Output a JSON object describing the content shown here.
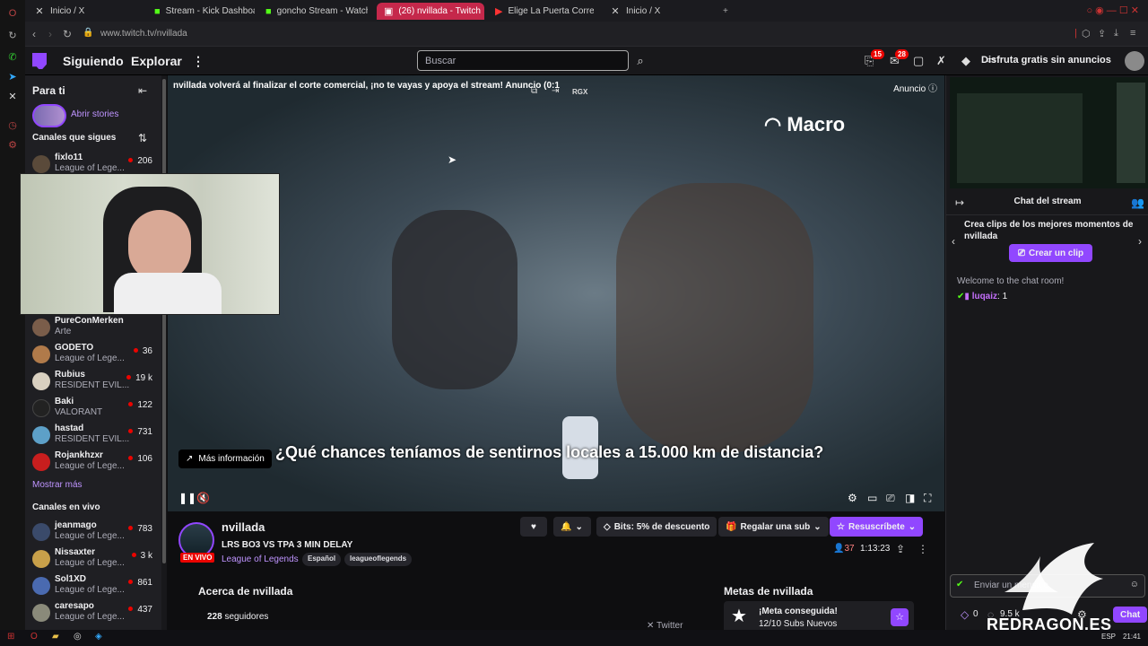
{
  "browser": {
    "tabs": [
      {
        "label": "Inicio / X",
        "icon": "x-logo-icon"
      },
      {
        "label": "Stream - Kick Dashboard",
        "icon": "kick-icon"
      },
      {
        "label": "goncho Stream - Watch L",
        "icon": "kick-icon"
      },
      {
        "label": "(26) nvillada - Twitch",
        "icon": "twitch-icon"
      },
      {
        "label": "Elige La Puerta Correc",
        "icon": "youtube-icon"
      },
      {
        "label": "Inicio / X",
        "icon": "x-logo-icon"
      }
    ],
    "new_tab": "+",
    "url": "www.twitch.tv/nvillada"
  },
  "topnav": {
    "following": "Siguiendo",
    "explore": "Explorar",
    "more": "⋮",
    "search_placeholder": "Buscar",
    "badge1": "15",
    "badge2": "28",
    "ad_free": "Disfruta gratis sin anuncios"
  },
  "sidebar": {
    "for_you": "Para ti",
    "stories": "Abrir stories",
    "followed_title": "Canales que sigues",
    "followed": [
      {
        "name": "fixlo11",
        "game": "League of Lege...",
        "viewers": "206",
        "color": "#5a4a3a"
      },
      {
        "name": "PureConMerken",
        "game": "Arte",
        "viewers": "",
        "color": "#7a5d4a"
      },
      {
        "name": "GODETO",
        "game": "League of Lege...",
        "viewers": "36",
        "color": "#b07a4a"
      },
      {
        "name": "Rubius",
        "game": "RESIDENT EVIL...",
        "viewers": "19 k",
        "color": "#d9d0c0"
      },
      {
        "name": "Baki",
        "game": "VALORANT",
        "viewers": "122",
        "color": "#222"
      },
      {
        "name": "hastad",
        "game": "RESIDENT EVIL...",
        "viewers": "731",
        "color": "#5da0c8"
      },
      {
        "name": "Rojankhzxr",
        "game": "League of Lege...",
        "viewers": "106",
        "color": "#c81e1e"
      }
    ],
    "show_more": "Mostrar más",
    "live_title": "Canales en vivo",
    "live": [
      {
        "name": "jeanmago",
        "game": "League of Lege...",
        "viewers": "783",
        "color": "#3a4a6a"
      },
      {
        "name": "Nissaxter",
        "game": "League of Lege...",
        "viewers": "3 k",
        "color": "#c8a04a"
      },
      {
        "name": "Sol1XD",
        "game": "League of Lege...",
        "viewers": "861",
        "color": "#4a6ab0"
      },
      {
        "name": "caresapo",
        "game": "League of Lege...",
        "viewers": "437",
        "color": "#8a8a7a"
      }
    ]
  },
  "video": {
    "ad_text": "nvillada volverá al finalizar el corte comercial, ¡no te vayas y apoya el stream! Anuncio (0:1",
    "ad_label": "Anuncio",
    "brand": "Macro",
    "subtitle": "¿Qué chances teníamos de sentirnos locales a 15.000 km de distancia?",
    "more_info": "Más información",
    "badge_rgx": "RGX"
  },
  "channel": {
    "name": "nvillada",
    "live": "EN VIVO",
    "title": "LRS BO3 VS TPA 3 MIN DELAY",
    "game": "League of Legends",
    "tags": [
      "Español",
      "leagueoflegends"
    ],
    "bits": "Bits: 5% de descuento",
    "gift": "Regalar una sub",
    "resub": "Resuscríbete",
    "viewers": "37",
    "uptime": "1:13:23",
    "about": "Acerca de nvillada",
    "followers_count": "228",
    "followers_label": "seguidores",
    "twitter": "Twitter",
    "goals": "Metas de nvillada",
    "goal_done": "¡Meta conseguida!",
    "goal_detail": "12/10 Subs Nuevos"
  },
  "chat": {
    "title": "Chat del stream",
    "clip_title": "Crea clips de los mejores momentos de nvillada",
    "clip_button": "Crear un clip",
    "welcome": "Welcome to the chat room!",
    "msg_user": "luqaiz",
    "msg_text": ": 1",
    "input_placeholder": "Enviar un mensaje",
    "points": "0",
    "points2": "9.5 k",
    "send": "Chat"
  },
  "watermark": "REDRAGON.ES",
  "taskbar": {
    "lang": "ESP",
    "time": "21:41"
  }
}
